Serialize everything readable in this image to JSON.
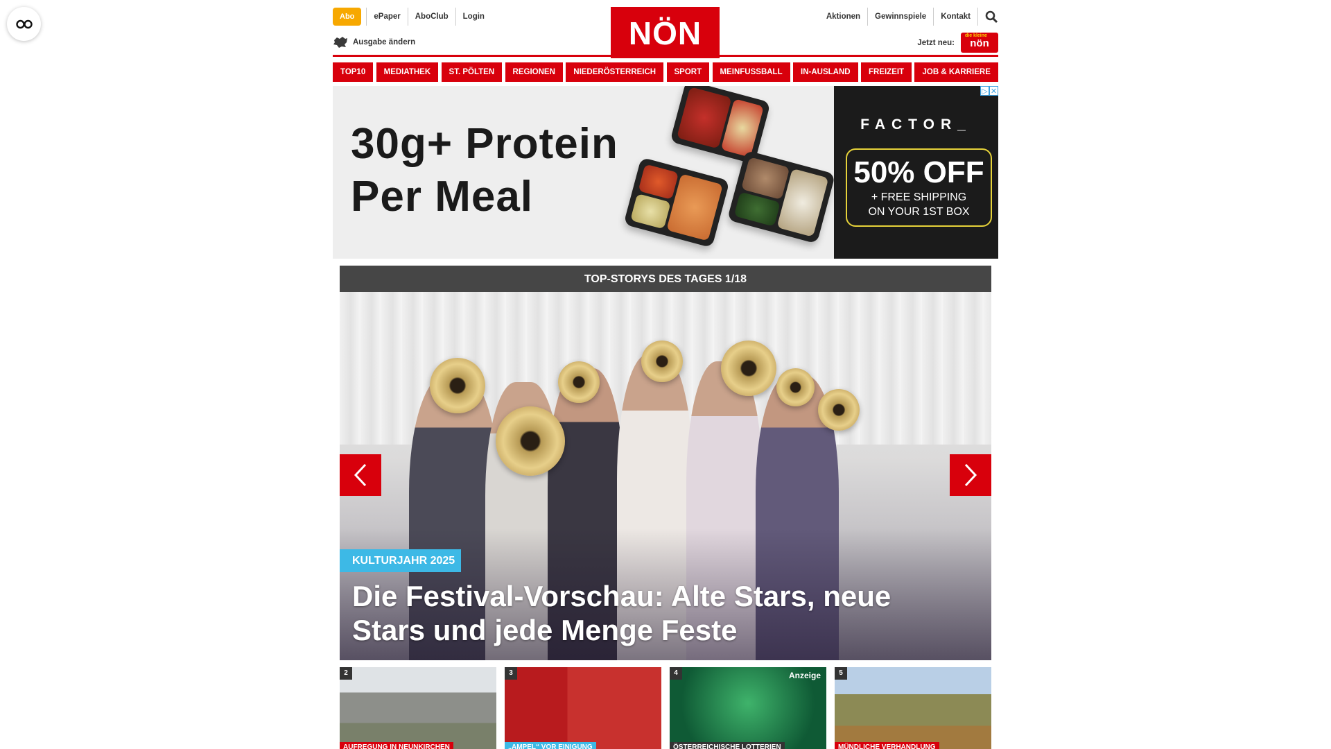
{
  "header": {
    "abo_label": "Abo",
    "top_links": [
      "ePaper",
      "AboClub",
      "Login"
    ],
    "edition_label": "Ausgabe ändern",
    "logo_text": "NÖN",
    "right_links": [
      "Aktionen",
      "Gewinnspiele",
      "Kontakt"
    ],
    "jetzt_label": "Jetzt neu:",
    "kids_logo_small": "die kleine",
    "kids_logo_text": "nön"
  },
  "nav": {
    "items": [
      "TOP10",
      "MEDIATHEK",
      "ST. PÖLTEN",
      "REGIONEN",
      "NIEDERÖSTERREICH",
      "SPORT",
      "MEINFUSSBALL",
      "IN-AUSLAND",
      "FREIZEIT",
      "JOB & KARRIERE"
    ]
  },
  "ad": {
    "headline_line1": "30g+ Protein",
    "headline_line2": "Per Meal",
    "brand": "FACTOR_",
    "offer": "50% OFF",
    "sub_line1": "+ FREE SHIPPING",
    "sub_line2": "ON YOUR 1ST BOX",
    "adchoice_i": "▷",
    "adchoice_x": "✕"
  },
  "slider": {
    "header": "TOP-STORYS DES TAGES 1/18",
    "category": "KULTURJAHR 2025",
    "title": "Die Festival-Vorschau: Alte Stars, neue Stars und jede Menge Feste"
  },
  "teasers": [
    {
      "num": "2",
      "tag": "AUFREGUNG IN NEUNKIRCHEN",
      "tag_color": "#d8000c"
    },
    {
      "num": "3",
      "tag": "„AMPEL“ VOR EINIGUNG",
      "tag_color": "#3db9e6"
    },
    {
      "num": "4",
      "tag": "ÖSTERREICHISCHE LOTTERIEN",
      "tag_color": "#333333",
      "ad_label": "Anzeige"
    },
    {
      "num": "5",
      "tag": "MÜNDLICHE VERHANDLUNG",
      "tag_color": "#d8000c"
    }
  ],
  "colors": {
    "brand_red": "#d8000c",
    "abo_orange": "#f7a800",
    "category_blue": "#3db9e6",
    "slider_header": "#464646"
  }
}
